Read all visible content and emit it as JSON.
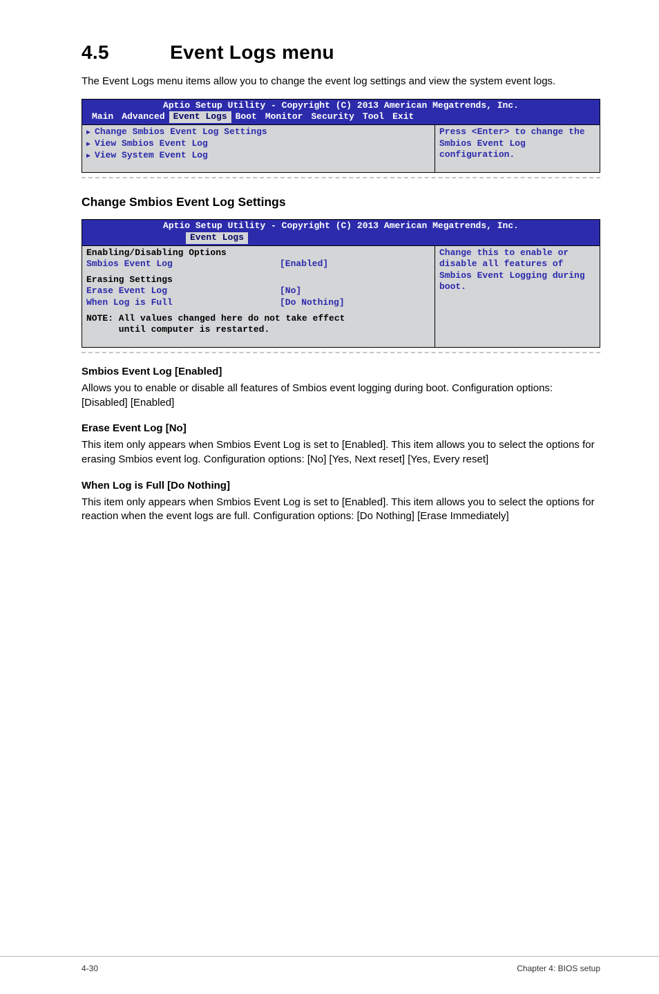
{
  "section": {
    "number": "4.5",
    "title": "Event Logs menu",
    "intro": "The Event Logs menu items allow you to change the event log settings and view the system event logs."
  },
  "bios1": {
    "top": "Aptio Setup Utility - Copyright (C) 2013 American Megatrends, Inc.",
    "tabs": [
      "Main",
      "Advanced",
      "Event Logs",
      "Boot",
      "Monitor",
      "Security",
      "Tool",
      "Exit"
    ],
    "active_tab_index": 2,
    "items": [
      "Change Smbios Event Log Settings",
      "View Smbios Event Log",
      "View System Event Log"
    ],
    "help": "Press <Enter> to change the Smbios Event Log configuration."
  },
  "subsection": "Change Smbios Event Log Settings",
  "bios2": {
    "top": "Aptio Setup Utility - Copyright (C) 2013 American Megatrends, Inc.",
    "tabs": [
      "Event Logs"
    ],
    "active_tab_index": 0,
    "group1": "Enabling/Disabling Options",
    "opt1_label": "Smbios Event Log",
    "opt1_value": "[Enabled]",
    "group2": "Erasing Settings",
    "opt2_label": "Erase Event Log",
    "opt2_value": "[No]",
    "opt3_label": "When Log is Full",
    "opt3_value": "[Do Nothing]",
    "note1": "NOTE: All values changed here do not take effect",
    "note2": "      until computer is restarted.",
    "help": "Change this to enable or disable all features of Smbios Event Logging during boot."
  },
  "opts": {
    "o1_title": "Smbios Event Log [Enabled]",
    "o1_p": "Allows you to enable or disable all features of Smbios event logging during boot. Configuration options: [Disabled] [Enabled]",
    "o2_title": "Erase Event Log [No]",
    "o2_p": "This item only appears when Smbios Event Log is set to [Enabled]. This item allows you to select the options for erasing Smbios event log. Configuration options: [No] [Yes, Next reset] [Yes, Every reset]",
    "o3_title": "When Log is Full [Do Nothing]",
    "o3_p": "This item only appears when Smbios Event Log is set to [Enabled]. This item allows you to select the options for reaction when the event logs are full. Configuration options: [Do Nothing] [Erase Immediately]"
  },
  "footer": {
    "left": "4-30",
    "right": "Chapter 4: BIOS setup"
  }
}
